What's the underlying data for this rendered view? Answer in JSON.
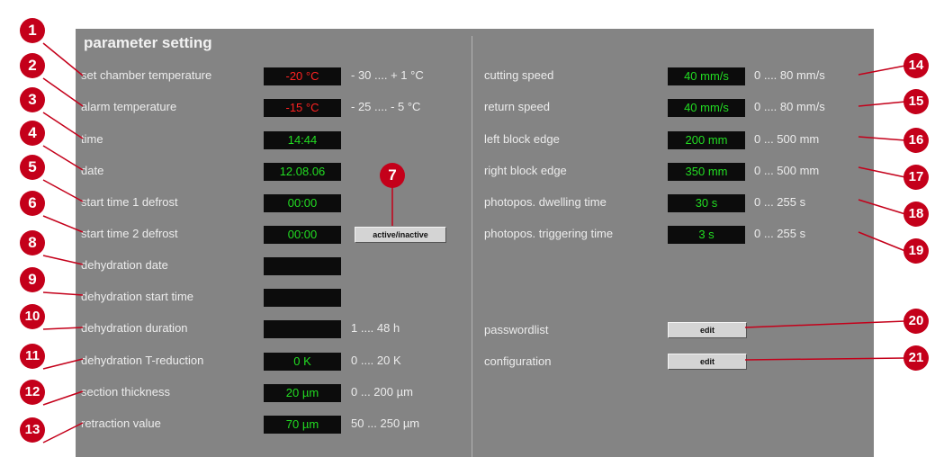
{
  "title": "parameter setting",
  "colors": {
    "panel": "#848484",
    "value_green": "#22dd22",
    "value_red": "#ff2222",
    "callout": "#c4001a"
  },
  "left_rows": [
    {
      "label": "set chamber temperature",
      "value": "-20 °C",
      "range": "- 30 .... + 1 °C",
      "value_color": "red"
    },
    {
      "label": "alarm temperature",
      "value": "-15 °C",
      "range": "- 25 .... - 5 °C",
      "value_color": "red"
    },
    {
      "label": "time",
      "value": "14:44",
      "range": ""
    },
    {
      "label": "date",
      "value": "12.08.06",
      "range": ""
    },
    {
      "label": "start time 1 defrost",
      "value": "00:00",
      "range": ""
    },
    {
      "label": "start time 2 defrost",
      "value": "00:00",
      "range": ""
    },
    {
      "label": "dehydration date",
      "value": "",
      "range": ""
    },
    {
      "label": "dehydration start time",
      "value": "",
      "range": ""
    },
    {
      "label": "dehydration duration",
      "value": "",
      "range": "1 .... 48 h"
    },
    {
      "label": "dehydration T-reduction",
      "value": "0 K",
      "range": "0 .... 20 K"
    },
    {
      "label": "section thickness",
      "value": "20 µm",
      "range": "0 ... 200 µm"
    },
    {
      "label": "retraction value",
      "value": "70 µm",
      "range": "50 ... 250 µm"
    }
  ],
  "defrost_toggle_label": "active/inactive",
  "right_rows": [
    {
      "label": "cutting speed",
      "value": "40 mm/s",
      "range": "0 .... 80 mm/s"
    },
    {
      "label": "return speed",
      "value": "40 mm/s",
      "range": "0 .... 80 mm/s"
    },
    {
      "label": "left block edge",
      "value": "200 mm",
      "range": "0 ... 500 mm"
    },
    {
      "label": "right block edge",
      "value": "350 mm",
      "range": "0 ... 500 mm"
    },
    {
      "label": "photopos. dwelling time",
      "value": "30 s",
      "range": "0 ... 255 s"
    },
    {
      "label": "photopos. triggering time",
      "value": "3 s",
      "range": "0 ... 255 s"
    }
  ],
  "password_label": "passwordlist",
  "password_button": "edit",
  "config_label": "configuration",
  "config_button": "edit",
  "callouts": [
    "1",
    "2",
    "3",
    "4",
    "5",
    "6",
    "7",
    "8",
    "9",
    "10",
    "11",
    "12",
    "13",
    "14",
    "15",
    "16",
    "17",
    "18",
    "19",
    "20",
    "21"
  ]
}
